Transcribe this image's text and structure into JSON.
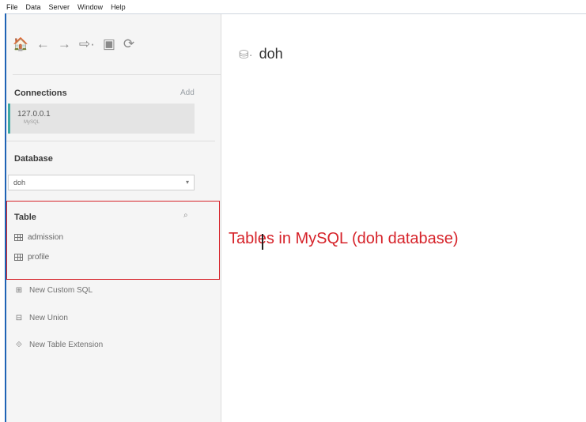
{
  "menu": [
    "File",
    "Data",
    "Server",
    "Window",
    "Help"
  ],
  "toolbar": {
    "icons": [
      "home-icon",
      "back-arrow-icon",
      "forward-arrow-icon",
      "exchange-icon",
      "save-icon",
      "refresh-icon"
    ],
    "glyphs": [
      "🏠",
      "←",
      "→",
      "⇨·",
      "▣",
      "⟳"
    ]
  },
  "connections": {
    "title": "Connections",
    "add_label": "Add",
    "item": {
      "host": "127.0.0.1",
      "type": "MySQL"
    }
  },
  "database": {
    "title": "Database",
    "selected": "doh"
  },
  "tables": {
    "title": "Table",
    "items": [
      "admission",
      "profile"
    ]
  },
  "actions": [
    {
      "label": "New Custom SQL",
      "icon": "custom-sql-icon",
      "glyph": "⊞"
    },
    {
      "label": "New Union",
      "icon": "union-icon",
      "glyph": "⊟"
    },
    {
      "label": "New Table Extension",
      "icon": "table-extension-icon",
      "glyph": "⟐"
    }
  ],
  "main": {
    "db_name": "doh",
    "annotation": "Tables in MySQL (doh database)"
  },
  "colors": {
    "accent_teal": "#3ea8a4",
    "highlight_red": "#d6232a",
    "window_blue": "#1e63b5"
  }
}
